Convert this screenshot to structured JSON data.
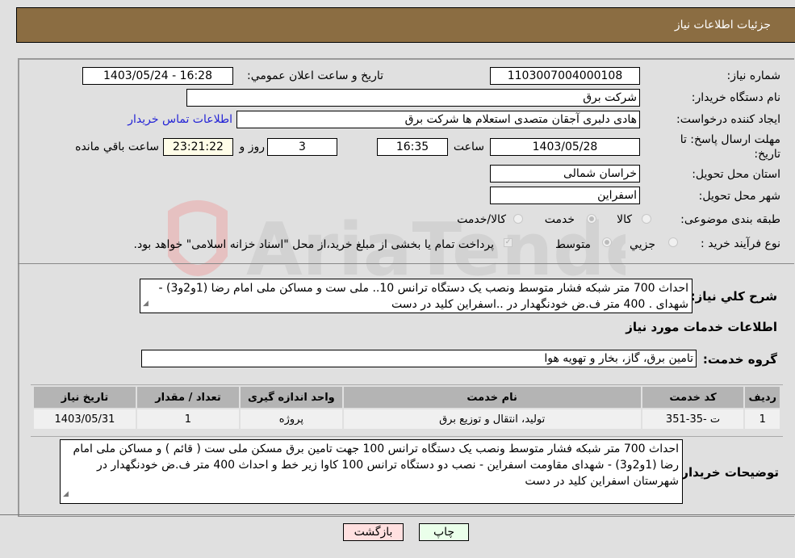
{
  "header": {
    "title": "جزئیات اطلاعات نیاز"
  },
  "form": {
    "need_number": {
      "label": "شماره نیاز:",
      "value": "1103007004000108"
    },
    "announce_datetime": {
      "label": "تاریخ و ساعت اعلان عمومي:",
      "value": "1403/05/24 - 16:28"
    },
    "buyer_org": {
      "label": "نام دستگاه خريدار:",
      "value": "شرکت برق"
    },
    "requester": {
      "label": "ايجاد کننده درخواست:",
      "value": "هادی دلبری آجقان متصدی استعلام ها  شرکت برق"
    },
    "buyer_contact_link": "اطلاعات تماس خريدار",
    "deadline": {
      "label": "مهلت ارسال پاسخ: تا تاريخ:",
      "date": "1403/05/28",
      "time_label": "ساعت",
      "time": "16:35",
      "days": "3",
      "days_label": "روز و",
      "remaining": "23:21:22",
      "remaining_label": "ساعت باقي مانده"
    },
    "province": {
      "label": "استان محل تحويل:",
      "value": "خراسان شمالی"
    },
    "city": {
      "label": "شهر محل تحويل:",
      "value": "اسفراين"
    },
    "category": {
      "label": "طبقه بندی موضوعی:",
      "options": [
        "کالا",
        "خدمت",
        "کالا/خدمت"
      ],
      "selected": "خدمت"
    },
    "process_type": {
      "label": "نوع فرآيند خريد :",
      "options": [
        "جزيي",
        "متوسط"
      ],
      "selected": "متوسط",
      "treasury_note": "پرداخت تمام يا بخشی از مبلغ خريد،از محل \"اسناد خزانه اسلامی\" خواهد بود.",
      "treasury_checked": true
    },
    "general_description": {
      "label": "شرح کلي نياز:",
      "value": "احداث 700 متر شبکه فشار متوسط ونصب یک دستگاه ترانس 10.. ملی ست و مساکن ملی امام رضا (1و2و3) - شهدای . 400 متر ف.ض خودنگهدار در ..اسفراین کلید در دست"
    }
  },
  "services": {
    "section_title": "اطلاعات خدمات مورد نياز",
    "group_label": "گروه خدمت:",
    "group_value": "تامين برق، گاز، بخار و تهويه هوا",
    "table": {
      "headers": [
        "رديف",
        "کد خدمت",
        "نام خدمت",
        "واحد اندازه گيری",
        "تعداد / مقدار",
        "تاريخ نياز"
      ],
      "rows": [
        [
          "1",
          "ت -35-351",
          "توليد، انتقال و توزيع برق",
          "پروژه",
          "1",
          "1403/05/31"
        ]
      ]
    }
  },
  "buyer_notes": {
    "label": "توضيحات خريدار:",
    "value": "احداث 700 متر شبکه فشار متوسط ونصب یک دستگاه ترانس 100 جهت تامین برق مسکن ملی ست ( قائم ) و مساکن ملی امام رضا (1و2و3) - شهدای مقاومت اسفراین - نصب دو دستگاه ترانس 100 کاوا زیر خط و احداث 400 متر ف.ض خودنگهدار در شهرستان اسفراین کلید در دست"
  },
  "buttons": {
    "print": "چاپ",
    "back": "بازگشت"
  },
  "colors": {
    "header_bg": "#8b6d42",
    "print_bg": "#eaffea",
    "back_bg": "#ffe0e0",
    "remaining_bg": "#fffde8",
    "link": "#2323d6"
  }
}
